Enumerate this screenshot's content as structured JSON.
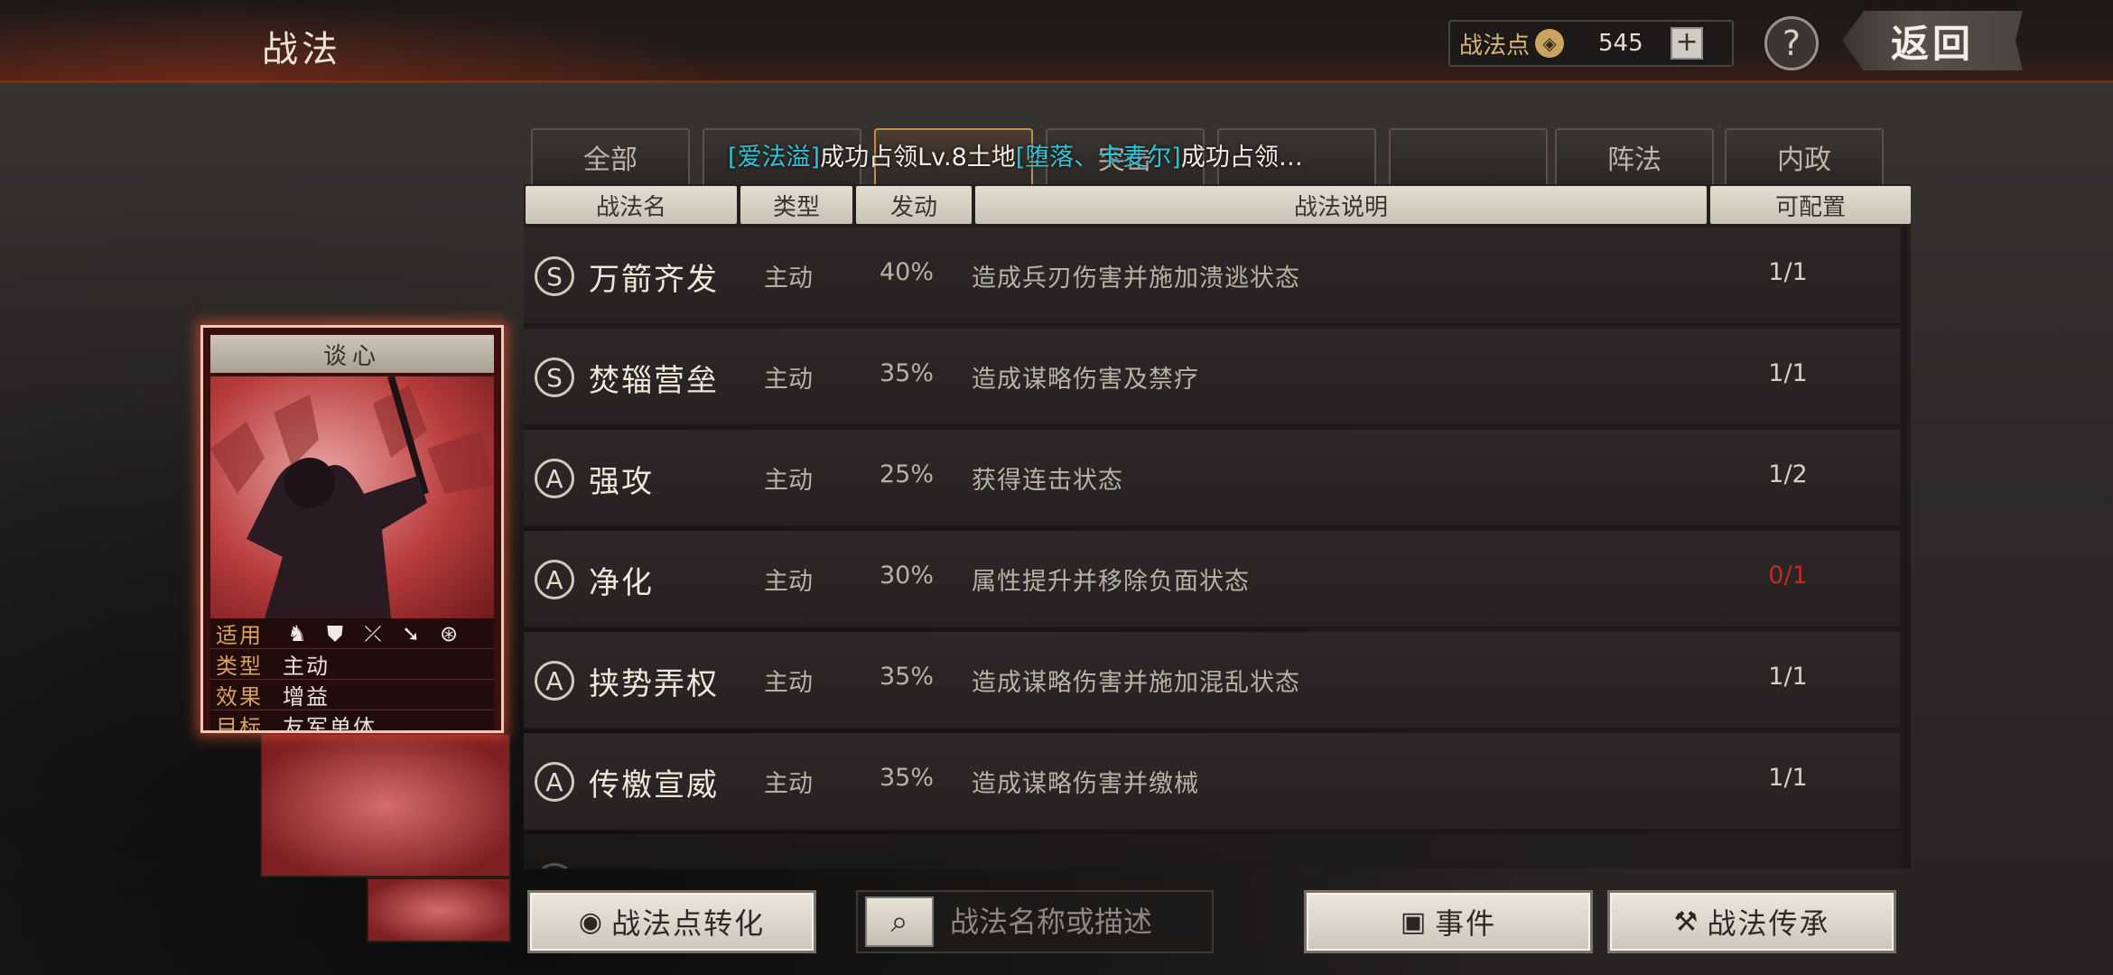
{
  "header": {
    "title": "战法",
    "points_label": "战法点",
    "points_value": "545",
    "plus": "+",
    "help": "?",
    "back": "返回"
  },
  "tabs": [
    {
      "label": "全部"
    },
    {
      "label": ""
    },
    {
      "label": ""
    },
    {
      "label": "突击"
    },
    {
      "label": ""
    },
    {
      "label": ""
    },
    {
      "label": "阵法"
    },
    {
      "label": "内政"
    }
  ],
  "notice": {
    "p1": "[爱法溢]",
    "p2": "成功占领Lv.8土地",
    "p3": "[堕落、卡麦尔]",
    "p4": "成功占领…"
  },
  "columns": {
    "name": "战法名",
    "type": "类型",
    "rate": "发动",
    "desc": "战法说明",
    "slots": "可配置"
  },
  "rows": [
    {
      "grade": "S",
      "name": "万箭齐发",
      "type": "主动",
      "rate": "40%",
      "desc": "造成兵刃伤害并施加溃逃状态",
      "slots": "1/1"
    },
    {
      "grade": "S",
      "name": "焚辎营垒",
      "type": "主动",
      "rate": "35%",
      "desc": "造成谋略伤害及禁疗",
      "slots": "1/1"
    },
    {
      "grade": "A",
      "name": "强攻",
      "type": "主动",
      "rate": "25%",
      "desc": "获得连击状态",
      "slots": "1/2"
    },
    {
      "grade": "A",
      "name": "净化",
      "type": "主动",
      "rate": "30%",
      "desc": "属性提升并移除负面状态",
      "slots": "0/1"
    },
    {
      "grade": "A",
      "name": "挟势弄权",
      "type": "主动",
      "rate": "35%",
      "desc": "造成谋略伤害并施加混乱状态",
      "slots": "1/1"
    },
    {
      "grade": "A",
      "name": "传檄宣威",
      "type": "主动",
      "rate": "35%",
      "desc": "造成谋略伤害并缴械",
      "slots": "1/1"
    }
  ],
  "card": {
    "title": "谈心",
    "apply_label": "适用",
    "type_label": "类型",
    "type_value": "主动",
    "effect_label": "效果",
    "effect_value": "增益",
    "target_label": "目标",
    "target_value": "友军单体",
    "apply_icons": [
      "cavalry-icon",
      "shield-icon",
      "bow-icon",
      "spear-icon",
      "wheel-icon"
    ]
  },
  "bottom": {
    "convert_label": "战法点转化",
    "search_placeholder": "战法名称或描述",
    "event_label": "事件",
    "inherit_label": "战法传承"
  },
  "colors": {
    "accent_red": "#c42a23",
    "notice_cyan": "#2fc4d6",
    "gold": "#d6b679"
  }
}
